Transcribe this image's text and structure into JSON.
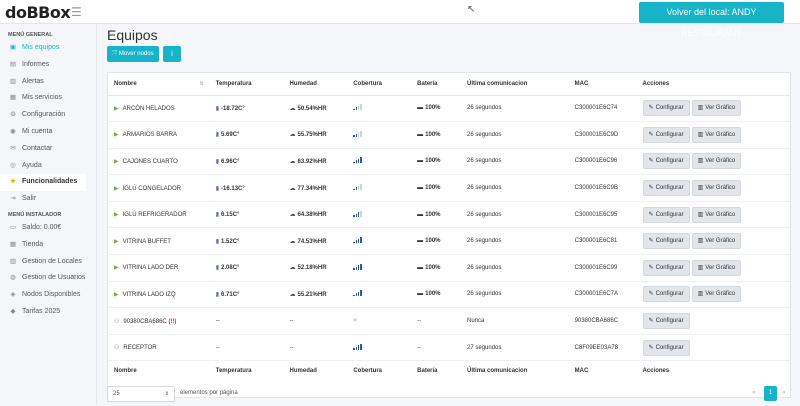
{
  "app": {
    "logo": "doBBox"
  },
  "header": {
    "back_button": "Volver del local: ANDY RESTAURANT"
  },
  "sidebar": {
    "section_general": "MENÚ GENERAL",
    "general_items": [
      {
        "label": "Mis equipos",
        "icon": "devices-icon"
      },
      {
        "label": "Informes",
        "icon": "report-icon"
      },
      {
        "label": "Alertas",
        "icon": "alert-icon"
      },
      {
        "label": "Mis servicios",
        "icon": "services-icon"
      },
      {
        "label": "Configuración",
        "icon": "gear-icon"
      },
      {
        "label": "Mi cuenta",
        "icon": "user-icon"
      },
      {
        "label": "Contactar",
        "icon": "mail-icon"
      },
      {
        "label": "Ayuda",
        "icon": "help-icon"
      },
      {
        "label": "Funcionalidades",
        "icon": "star-icon"
      },
      {
        "label": "Salir",
        "icon": "logout-icon"
      }
    ],
    "section_installer": "MENÚ INSTALADOR",
    "installer_items": [
      {
        "label": "Saldo: 0.00€",
        "icon": "wallet-icon"
      },
      {
        "label": "Tienda",
        "icon": "store-icon"
      },
      {
        "label": "Gestion de Locales",
        "icon": "building-icon"
      },
      {
        "label": "Gestion de Usuarios",
        "icon": "users-icon"
      },
      {
        "label": "Nodos Disponibles",
        "icon": "node-icon"
      },
      {
        "label": "Tarifas 2025",
        "icon": "tag-icon"
      }
    ]
  },
  "main": {
    "title": "Equipos",
    "move_button": "Mover nodos",
    "info_button": "i"
  },
  "table": {
    "columns": [
      "Nombre",
      "Temperatura",
      "Humedad",
      "Cobertura",
      "Batería",
      "Última comunicacion",
      "MAC",
      "Acciones"
    ],
    "configure_label": "Configurar",
    "chart_label": "Ver Gráfico",
    "rows": [
      {
        "name": "ARCÓN HELADOS",
        "temp": "-18.72C°",
        "hum": "50.54%HR",
        "cov": 2,
        "bat": "100%",
        "last": "26 segundos",
        "mac": "C300001E6C74",
        "type": "sensor"
      },
      {
        "name": "ARMARIOS BARRA",
        "temp": "5.69C°",
        "hum": "55.75%HR",
        "cov": 2,
        "bat": "100%",
        "last": "26 segundos",
        "mac": "C300001E6C9D",
        "type": "sensor"
      },
      {
        "name": "CAJONES CUARTO",
        "temp": "6.96C°",
        "hum": "63.92%HR",
        "cov": 4,
        "bat": "100%",
        "last": "26 segundos",
        "mac": "C300001E6C96",
        "type": "sensor"
      },
      {
        "name": "IGLÚ CONGELADOR",
        "temp": "-16.13C°",
        "hum": "77.34%HR",
        "cov": 2,
        "bat": "100%",
        "last": "26 segundos",
        "mac": "C300001E6C9B",
        "type": "sensor"
      },
      {
        "name": "IGLÚ REFRIGERADOR",
        "temp": "6.15C°",
        "hum": "64.38%HR",
        "cov": 3,
        "bat": "100%",
        "last": "26 segundos",
        "mac": "C300001E6C95",
        "type": "sensor"
      },
      {
        "name": "VITRINA BUFFET",
        "temp": "1.52C°",
        "hum": "74.53%HR",
        "cov": 4,
        "bat": "100%",
        "last": "26 segundos",
        "mac": "C300001E6C81",
        "type": "sensor"
      },
      {
        "name": "VITRINA LADO DER",
        "temp": "2.08C°",
        "hum": "52.18%HR",
        "cov": 4,
        "bat": "100%",
        "last": "26 segundos",
        "mac": "C300001E6C99",
        "type": "sensor"
      },
      {
        "name": "VITRINA LADO IZQ",
        "temp": "6.71C°",
        "hum": "55.21%HR",
        "cov": 4,
        "bat": "100%",
        "last": "26 segundos",
        "mac": "C300001E6C7A",
        "type": "sensor"
      },
      {
        "name": "90380CBA686C",
        "flag": "(!!)",
        "temp": "--",
        "hum": "--",
        "cov": 0,
        "bat": "--",
        "last": "Nunca",
        "mac": "90380CBA686C",
        "type": "node"
      },
      {
        "name": "RECEPTOR",
        "temp": "--",
        "hum": "--",
        "cov": 4,
        "bat": "--",
        "last": "27 segundos",
        "mac": "C8F09EE03A78",
        "type": "receiver"
      }
    ]
  },
  "pagination": {
    "per_page": "25",
    "per_page_label": "elementos por página",
    "prev": "«",
    "current": "1",
    "next": "»"
  }
}
